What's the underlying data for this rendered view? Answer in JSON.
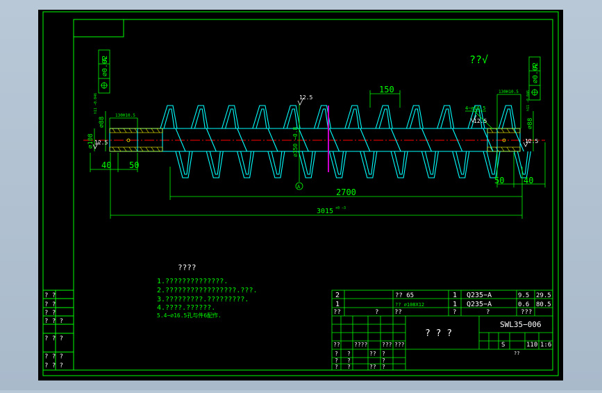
{
  "colors": {
    "background": "#000000",
    "frame": "#00ff00",
    "outline": "#00ffff",
    "centerline": "#ff0000",
    "text_dim": "#00ff00",
    "text_white": "#ffffff",
    "section_mark": "#cc00cc",
    "hatch": "#ffff00"
  },
  "tolerance": {
    "left": {
      "flatness": "⌀0.02",
      "datum": "A"
    },
    "right": {
      "flatness": "⌀0.02",
      "datum": "A"
    },
    "roughness_all": "??√"
  },
  "dimensions": {
    "pitch": "150",
    "screw_length": "2700",
    "total_length": "3015",
    "total_length_tol": "+0 −3",
    "left_end_40": "40",
    "left_end_50": "50",
    "right_end_50": "50",
    "right_end_40": "40",
    "left_shaft_dia": "⌀108",
    "left_hub_dia": "⌀88",
    "left_hub_fit": "h11 −0.046",
    "left_bore": "130H10.5",
    "right_bore": "130H10.5",
    "right_hub_dia": "⌀88",
    "right_hub_fit": "h11 −0.046",
    "outer_dia": "⌀350 −0.8",
    "hole_callout": "4−⌀16.5",
    "datum_label": "A",
    "roughness_top": "12.5",
    "roughness_left": "12.5",
    "roughness_right": "12.5",
    "roughness_hole": "12.5"
  },
  "notes": {
    "title": "????",
    "lines": [
      "1.??????????????.",
      "2.?????????????????.???.",
      "3.?????????.?????????.",
      "4.????.??????.",
      "5.4−⌀16.5孔与件6配作."
    ]
  },
  "left_table": {
    "rows": [
      "? ?",
      "? ?",
      "? ?",
      "? ? ?",
      "? ? ?",
      "? ? ?",
      "? ? ?"
    ]
  },
  "bom": {
    "rows": [
      {
        "no": "2",
        "name": "?? 65",
        "qty": "1",
        "material": "Q235−A",
        "unit": "9.5",
        "total": "29.5"
      },
      {
        "no": "1",
        "name": "?? ⌀108X12",
        "qty": "1",
        "material": "Q235−A",
        "unit": "0.6",
        "total": "80.5"
      }
    ],
    "header": [
      "??",
      "?",
      "??",
      "?",
      "?",
      "???"
    ]
  },
  "title_block": {
    "part_name": "? ? ?",
    "drawing_no": "SWL35−006",
    "scale_label": "S",
    "mass": "110",
    "scale": "1:6",
    "sheet": "??",
    "grid_row1": [
      "??",
      "????",
      "???",
      "???"
    ],
    "grid_row2": [
      "?",
      "?",
      "??",
      "?"
    ],
    "grid_row3": [
      "?",
      "?",
      "?"
    ],
    "grid_row4": [
      "?",
      "?",
      "??",
      "?"
    ]
  }
}
